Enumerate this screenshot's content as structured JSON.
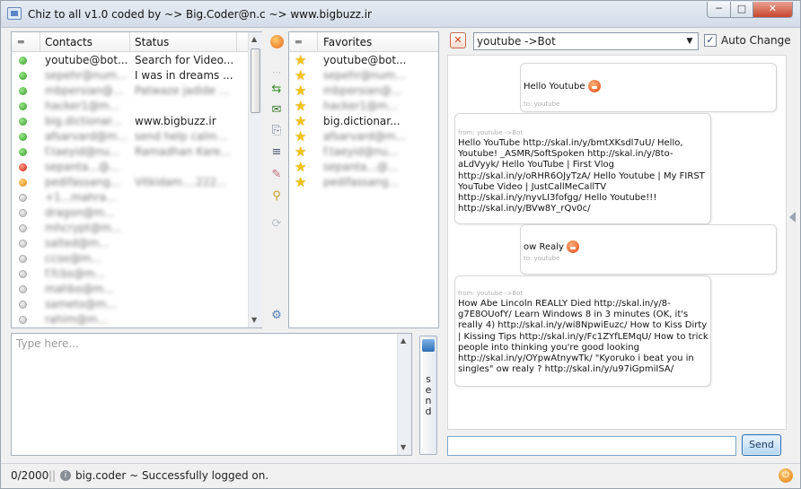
{
  "window": {
    "title": "Chiz to all v1.0 coded by ~> Big.Coder@n.c ~> www.bigbuzz.ir",
    "min_label": "─",
    "max_label": "□",
    "close_label": "✕"
  },
  "contacts": {
    "col_contacts": "Contacts",
    "col_status": "Status",
    "rows": [
      {
        "name": "youtube@bot...",
        "status": "Search for Video...",
        "presence": "on",
        "blur": false
      },
      {
        "name": "sepehr@num...",
        "status": "I was in dreams ...",
        "presence": "on",
        "blur": true,
        "status_blur": false
      },
      {
        "name": "mbpersian@...",
        "status": "Patwaze jadide ...",
        "presence": "on",
        "blur": true,
        "status_blur": true
      },
      {
        "name": "hacker1@m...",
        "status": "",
        "presence": "on",
        "blur": true
      },
      {
        "name": "big.dictionar...",
        "status": "www.bigbuzz.ir",
        "presence": "on",
        "blur": true,
        "status_blur": false
      },
      {
        "name": "afsarvard@m...",
        "status": "send help calm...",
        "presence": "on",
        "blur": true,
        "status_blur": true
      },
      {
        "name": "f.taeyid@nu...",
        "status": "Ramadhan Kare...",
        "presence": "on",
        "blur": true,
        "status_blur": true
      },
      {
        "name": "sepanta...@...",
        "status": "",
        "presence": "busy",
        "blur": true
      },
      {
        "name": "pedifassang...",
        "status": "Vitkidam....222...",
        "presence": "away",
        "blur": true,
        "status_blur": true
      },
      {
        "name": "+1...mahra...",
        "status": "",
        "presence": "off",
        "blur": true
      },
      {
        "name": "dragon@m...",
        "status": "",
        "presence": "off",
        "blur": true
      },
      {
        "name": "mhcrypt@m...",
        "status": "",
        "presence": "off",
        "blur": true
      },
      {
        "name": "salted@m...",
        "status": "",
        "presence": "off",
        "blur": true
      },
      {
        "name": "ccoo@m...",
        "status": "",
        "presence": "off",
        "blur": true
      },
      {
        "name": "f.fcbs@m...",
        "status": "",
        "presence": "off",
        "blur": true
      },
      {
        "name": "mahbo@m...",
        "status": "",
        "presence": "off",
        "blur": true
      },
      {
        "name": "sameto@m...",
        "status": "",
        "presence": "off",
        "blur": true
      },
      {
        "name": "rahim@m...",
        "status": "",
        "presence": "off",
        "blur": true
      }
    ]
  },
  "favorites": {
    "col_label": "Favorites",
    "rows": [
      {
        "name": "youtube@bot...",
        "blur": false
      },
      {
        "name": "sepehr@num...",
        "blur": true
      },
      {
        "name": "mbpersian@...",
        "blur": true
      },
      {
        "name": "hacker1@m...",
        "blur": true
      },
      {
        "name": "big.dictionar...",
        "blur": false
      },
      {
        "name": "afsarvard@m...",
        "blur": true
      },
      {
        "name": "f.taeyid@nu...",
        "blur": true
      },
      {
        "name": "sepanta...@...",
        "blur": true
      },
      {
        "name": "pedifassang...",
        "blur": true
      }
    ]
  },
  "chat": {
    "recipient": "youtube ->Bot",
    "auto_change_label": "Auto Change",
    "auto_change_checked": "✓",
    "messages": [
      {
        "from": "to: youtube",
        "text": "Hello Youtube"
      },
      {
        "from": "from: youtube ->Bot",
        "text": "Hello YouTube http://skal.in/y/bmtXKsdl7uU/ Hello, Youtube! _ASMR/SoftSpoken http://skal.in/y/8to-aLdVyyk/ Hello YouTube | First Vlog http://skal.in/y/oRHR6OJyTzA/ Hello Youtube | My FIRST YouTube Video | JustCallMeCallTV http://skal.in/y/nyvLI3fofgg/ Hello Youtube!!! http://skal.in/y/BVw8Y_rQv0c/"
      },
      {
        "from": "to: youtube",
        "text": "ow Realy"
      },
      {
        "from": "from: youtube ->Bot",
        "text": "How Abe Lincoln REALLY Died http://skal.in/y/8-g7E8OUofY/ Learn Windows 8 in 3 minutes (OK, it's really 4) http://skal.in/y/wi8NpwiEuzc/ How to Kiss Dirty | Kissing Tips http://skal.in/y/Fc1ZYfLEMqU/ How to trick people into thinking you're good looking http://skal.in/y/OYpwAtnywTk/ \"Kyoruko i beat you in singles\" ow realy ? http://skal.in/y/u97iGpmiISA/"
      }
    ],
    "send_label": "Send"
  },
  "compose": {
    "placeholder": "Type here...",
    "send_vertical": "send"
  },
  "status": {
    "counter": "0/2000",
    "separator": "||",
    "user_text": "big.coder ~ Successfully logged on."
  },
  "icons": [
    "app-icon",
    "buddy-icon",
    "move-to-favorites-icon",
    "message-icon",
    "history-icon",
    "sort-icon",
    "eraser-icon",
    "broom-icon",
    "refresh-icon",
    "settings-icon",
    "close-chat-icon",
    "attach-icon",
    "power-icon",
    "info-icon"
  ]
}
